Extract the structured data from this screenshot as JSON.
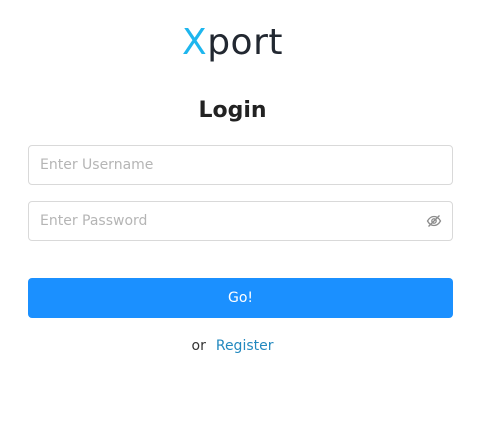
{
  "logo": {
    "first_letter": "X",
    "rest": "port",
    "accent_color": "#1eb6ee"
  },
  "form": {
    "title": "Login",
    "username_placeholder": "Enter Username",
    "username_value": "",
    "password_placeholder": "Enter Password",
    "password_value": "",
    "password_toggle_icon": "eye-invisible-icon",
    "submit_label": "Go!",
    "submit_color": "#1b90ff",
    "alt_prefix": "or",
    "register_label": "Register"
  }
}
